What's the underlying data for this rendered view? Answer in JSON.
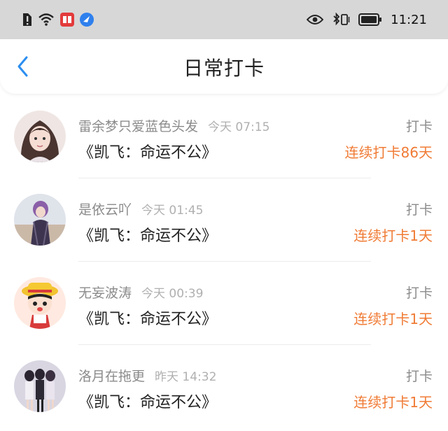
{
  "status_bar": {
    "time": "11:21",
    "icons_left": [
      "alert-icon",
      "wifi-icon",
      "book-app-icon",
      "browser-app-icon"
    ],
    "icons_right": [
      "eye-icon",
      "bluetooth-vibrate-icon",
      "battery-icon"
    ]
  },
  "header": {
    "title": "日常打卡",
    "back_icon": "chevron-left-icon",
    "accent": "#2b8ef0"
  },
  "checkins": [
    {
      "user": "雷余梦只爱蓝色头发",
      "time": "今天 07:15",
      "book": "《凯飞：命运不公》",
      "tag": "打卡",
      "streak": "连续打卡86天"
    },
    {
      "user": "是依云吖",
      "time": "今天 01:45",
      "book": "《凯飞：命运不公》",
      "tag": "打卡",
      "streak": "连续打卡1天"
    },
    {
      "user": "无妄波涛",
      "time": "今天 00:39",
      "book": "《凯飞：命运不公》",
      "tag": "打卡",
      "streak": "连续打卡1天"
    },
    {
      "user": "洛月在拖更",
      "time": "昨天 14:32",
      "book": "《凯飞：命运不公》",
      "tag": "打卡",
      "streak": "连续打卡1天"
    }
  ],
  "colors": {
    "streak": "#f07b35",
    "muted": "#8b8b8b",
    "status_bar": "#d7d7d7"
  }
}
